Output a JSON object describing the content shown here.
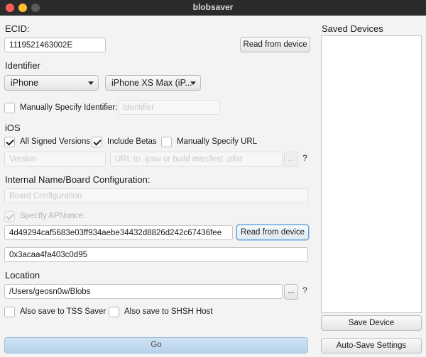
{
  "window": {
    "title": "blobsaver"
  },
  "ecid": {
    "label": "ECID:",
    "value": "1119521463002E",
    "read_button": "Read from device"
  },
  "identifier": {
    "label": "Identifier",
    "device_type": "iPhone",
    "device_model": "iPhone XS Max (iP...",
    "manual_label": "Manually Specify Identifier:",
    "manual_checked": false,
    "manual_placeholder": "Identifier"
  },
  "ios": {
    "label": "iOS",
    "all_signed_label": "All Signed Versions",
    "all_signed_checked": true,
    "include_betas_label": "Include Betas",
    "include_betas_checked": true,
    "manual_url_label": "Manually Specify URL",
    "manual_url_checked": false,
    "version_placeholder": "Version",
    "url_placeholder": "URL to .ipsw or build manifest .plist",
    "browse_label": "...",
    "help_label": "?"
  },
  "board": {
    "label": "Internal Name/Board Configuration:",
    "placeholder": "Board Configuration"
  },
  "apnonce": {
    "label": "Specify APNonce:",
    "checked": true,
    "value": "4d49294caf5683e03ff934aebe34432d8826d242c67436fee",
    "read_button": "Read from device",
    "generator": "0x3acaa4fa403c0d95"
  },
  "location": {
    "label": "Location",
    "path": "/Users/geosn0w/Blobs",
    "browse_label": "...",
    "help_label": "?",
    "tss_label": "Also save to TSS Saver",
    "tss_checked": false,
    "shsh_label": "Also save to SHSH Host",
    "shsh_checked": false
  },
  "actions": {
    "go": "Go"
  },
  "saved_devices": {
    "title": "Saved Devices",
    "items": [],
    "save_button": "Save Device",
    "auto_save_button": "Auto-Save Settings"
  }
}
